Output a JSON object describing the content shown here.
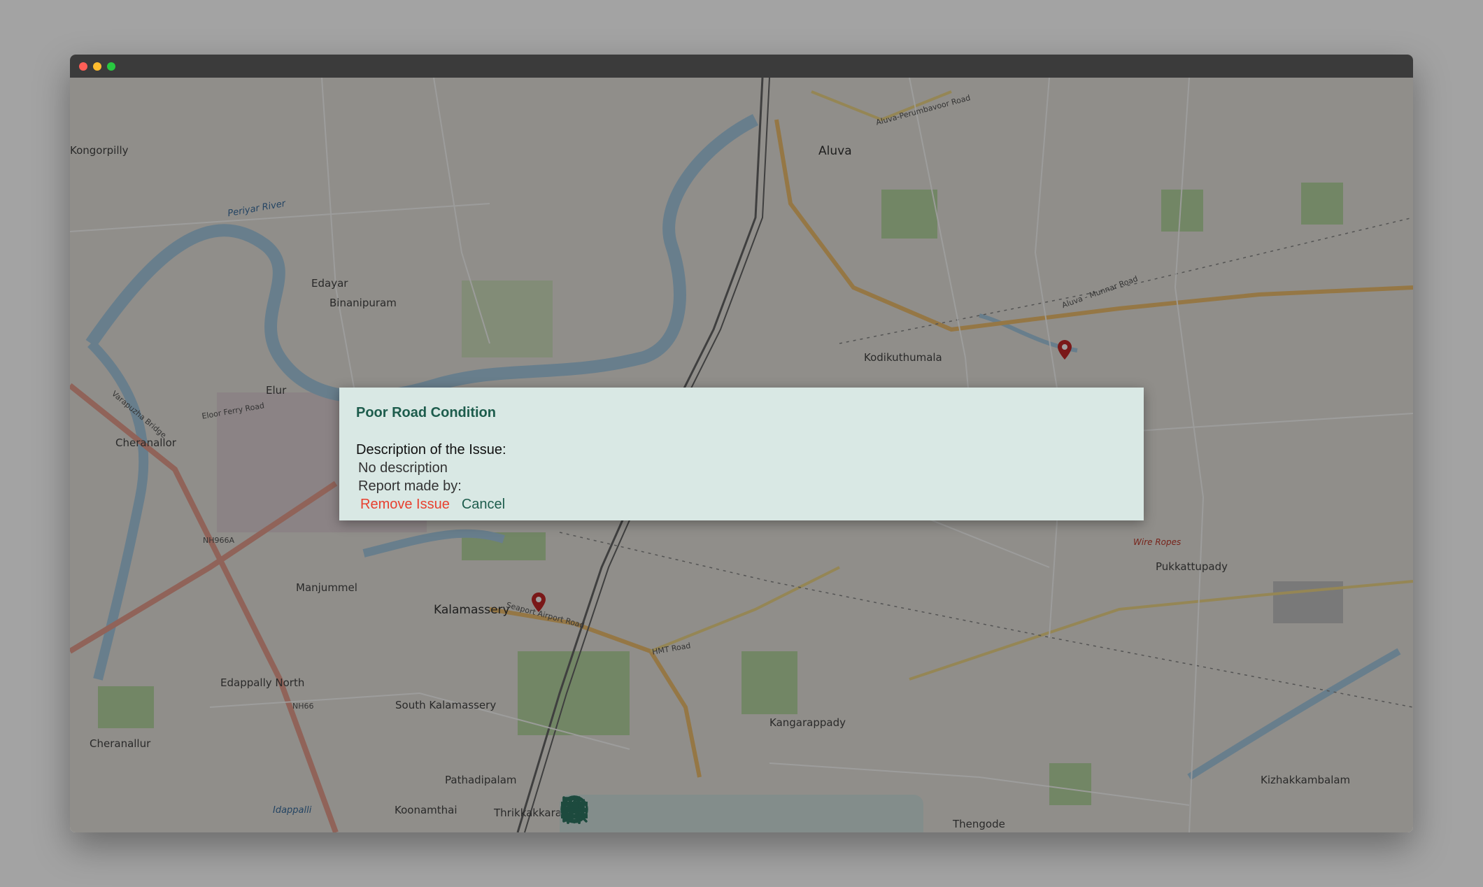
{
  "map": {
    "places": [
      {
        "name": "Aluva",
        "size": "big"
      },
      {
        "name": "Kongorpilly",
        "size": "normal"
      },
      {
        "name": "Edayar",
        "size": "normal"
      },
      {
        "name": "Binanipuram",
        "size": "normal"
      },
      {
        "name": "Elur",
        "size": "normal"
      },
      {
        "name": "Cheranallor",
        "size": "normal"
      },
      {
        "name": "Manjummel",
        "size": "normal"
      },
      {
        "name": "Kalamassery",
        "size": "big"
      },
      {
        "name": "Edappally North",
        "size": "normal"
      },
      {
        "name": "South Kalamassery",
        "size": "normal"
      },
      {
        "name": "Cheranallur",
        "size": "normal"
      },
      {
        "name": "Pathadipalam",
        "size": "normal"
      },
      {
        "name": "Koonamthai",
        "size": "normal"
      },
      {
        "name": "Thrikkakkara",
        "size": "normal"
      },
      {
        "name": "Kodikuthumala",
        "size": "normal"
      },
      {
        "name": "Pukkattupady",
        "size": "normal"
      },
      {
        "name": "Kangarappady",
        "size": "normal"
      },
      {
        "name": "Kizhakkambalam",
        "size": "normal"
      },
      {
        "name": "Thengode",
        "size": "normal"
      },
      {
        "name": "Aluva-Perumbavoor Road",
        "size": "small"
      },
      {
        "name": "Aluva - Munnar Road",
        "size": "small"
      },
      {
        "name": "Periyar River",
        "size": "blue"
      },
      {
        "name": "Seaport Airport Road",
        "size": "small"
      },
      {
        "name": "HMT Road",
        "size": "small"
      },
      {
        "name": "Eloor Ferry Road",
        "size": "small"
      },
      {
        "name": "NH966A",
        "size": "small"
      },
      {
        "name": "NH66",
        "size": "small"
      },
      {
        "name": "Wire Ropes",
        "size": "red"
      },
      {
        "name": "Idappalli",
        "size": "blue"
      },
      {
        "name": "Varapuzha Bridge",
        "size": "small"
      }
    ]
  },
  "dialog": {
    "title": "Poor Road Condition",
    "description_label": "Description of the Issue:",
    "description": "No description",
    "reporter_label": "Report made by:",
    "remove_label": "Remove Issue",
    "cancel_label": "Cancel"
  },
  "toolbar": {
    "tools": [
      "road-closed-icon",
      "water-drop-icon",
      "traffic-light-icon",
      "pedestrian-icon",
      "road-lanes-icon",
      "alert-icon",
      "location-pin-icon",
      "logout-icon"
    ]
  },
  "colors": {
    "dialog_bg": "#d9e8e4",
    "accent": "#1d5c4c",
    "danger": "#e8402f",
    "pin": "#c62828"
  }
}
